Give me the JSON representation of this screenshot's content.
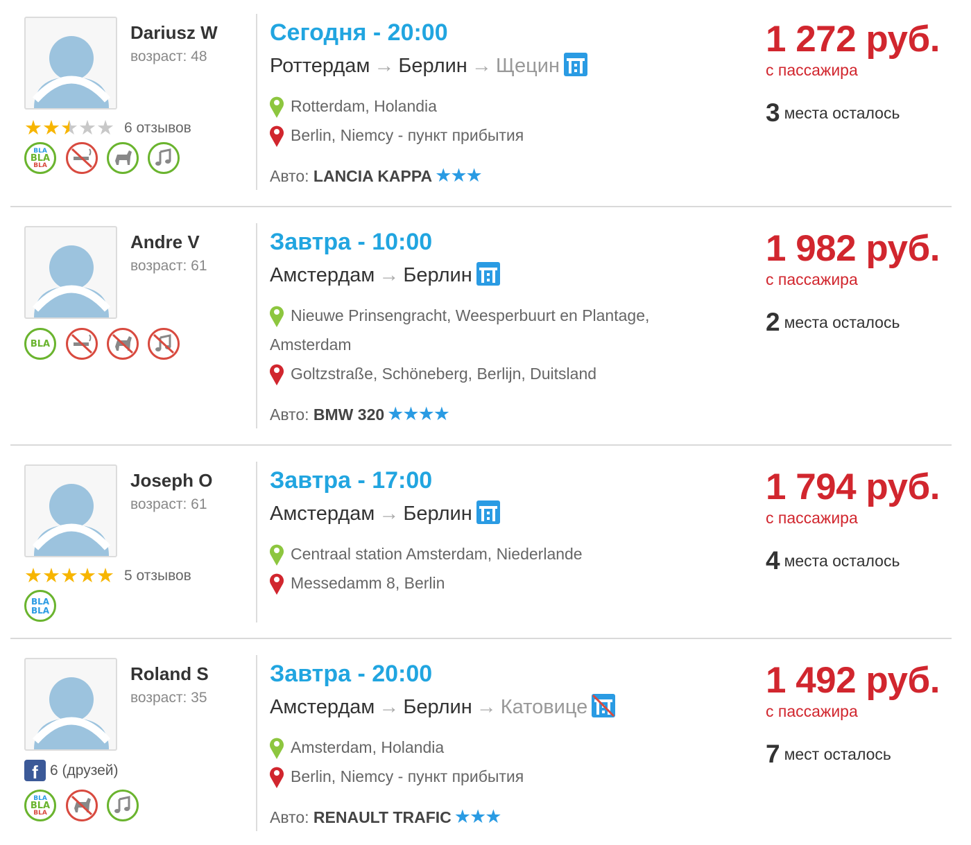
{
  "rides": [
    {
      "driver": {
        "name": "Dariusz W",
        "age": "возраст: 48",
        "rating": 2.5,
        "reviews": "6 отзывов",
        "friends": null,
        "prefs": [
          {
            "icon": "bla-bla-chatty-icon",
            "allowed": true,
            "level": 3
          },
          {
            "icon": "no-smoking-icon",
            "allowed": false
          },
          {
            "icon": "pets-allowed-icon",
            "allowed": true
          },
          {
            "icon": "music-icon",
            "allowed": true
          }
        ]
      },
      "when": "Сегодня - 20:00",
      "route": {
        "from": "Роттердам",
        "to": "Берлин",
        "via": "Щецин",
        "highway": true
      },
      "pickup": [
        "Rotterdam, Holandia"
      ],
      "dropoff": [
        "Berlin, Niemcy - пункт прибытия"
      ],
      "car": {
        "label": "Авто:",
        "model": "LANCIA KAPPA",
        "comfort": 3
      },
      "price": "1 272 руб.",
      "per": "с пассажира",
      "seats": {
        "count": "3",
        "text": "места осталось"
      }
    },
    {
      "driver": {
        "name": "Andre V",
        "age": "возраст: 61",
        "rating": null,
        "reviews": null,
        "friends": null,
        "prefs": [
          {
            "icon": "bla-quiet-icon",
            "allowed": true,
            "level": 1
          },
          {
            "icon": "no-smoking-icon",
            "allowed": false
          },
          {
            "icon": "no-pets-icon",
            "allowed": false
          },
          {
            "icon": "no-music-icon",
            "allowed": false
          }
        ]
      },
      "when": "Завтра - 10:00",
      "route": {
        "from": "Амстердам",
        "to": "Берлин",
        "via": null,
        "highway": true
      },
      "pickup": [
        "Nieuwe Prinsengracht, Weesperbuurt en Plantage,",
        "Amsterdam"
      ],
      "dropoff": [
        "Goltzstraße, Schöneberg, Berlijn, Duitsland"
      ],
      "car": {
        "label": "Авто:",
        "model": "BMW 320",
        "comfort": 4
      },
      "price": "1 982 руб.",
      "per": "с пассажира",
      "seats": {
        "count": "2",
        "text": "места осталось"
      }
    },
    {
      "driver": {
        "name": "Joseph O",
        "age": "возраст: 61",
        "rating": 5,
        "reviews": "5 отзывов",
        "friends": null,
        "prefs": [
          {
            "icon": "bla-bla-icon",
            "allowed": true,
            "level": 2
          }
        ]
      },
      "when": "Завтра - 17:00",
      "route": {
        "from": "Амстердам",
        "to": "Берлин",
        "via": null,
        "highway": true
      },
      "pickup": [
        "Centraal station Amsterdam, Niederlande"
      ],
      "dropoff": [
        "Messedamm 8, Berlin"
      ],
      "car": null,
      "price": "1 794 руб.",
      "per": "с пассажира",
      "seats": {
        "count": "4",
        "text": "места осталось"
      }
    },
    {
      "driver": {
        "name": "Roland S",
        "age": "возраст: 35",
        "rating": null,
        "reviews": null,
        "friends": "6 (друзей)",
        "prefs": [
          {
            "icon": "bla-bla-chatty-icon",
            "allowed": true,
            "level": 3
          },
          {
            "icon": "no-pets-icon",
            "allowed": false
          },
          {
            "icon": "music-icon",
            "allowed": true
          }
        ]
      },
      "when": "Завтра - 20:00",
      "route": {
        "from": "Амстердам",
        "to": "Берлин",
        "via": "Катовице",
        "highway": false
      },
      "pickup": [
        "Amsterdam, Holandia"
      ],
      "dropoff": [
        "Berlin, Niemcy - пункт прибытия"
      ],
      "car": {
        "label": "Авто:",
        "model": "RENAULT TRAFIC",
        "comfort": 3
      },
      "price": "1 492 руб.",
      "per": "с пассажира",
      "seats": {
        "count": "7",
        "text": "мест осталось"
      }
    }
  ],
  "colors": {
    "accent": "#21a5e0",
    "price": "#d1262e",
    "ok": "#6ab42e",
    "forbidden": "#d84a3f",
    "star": "#f7b500",
    "comfort": "#2a9be3"
  }
}
